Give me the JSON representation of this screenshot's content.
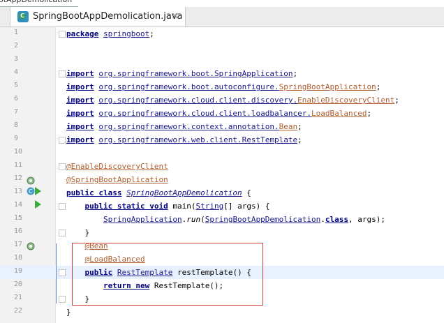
{
  "breadcrumb": "otAppDemolication",
  "tab": {
    "title": "SpringBootAppDemolication.java",
    "close": "×"
  },
  "lines": [
    {
      "n": "1",
      "html": "<span class=\"kw\">package</span> <span class=\"pk\">springboot</span>;"
    },
    {
      "n": "2",
      "html": ""
    },
    {
      "n": "3",
      "html": ""
    },
    {
      "n": "4",
      "html": "<span class=\"kw\">import</span> <span class=\"pk\">org.springframework.boot.SpringApplication</span>;"
    },
    {
      "n": "5",
      "html": "<span class=\"kw\">import</span> <span class=\"pk\">org.springframework.boot.autoconfigure.</span><span class=\"gi\">SpringBootApplication</span>;"
    },
    {
      "n": "6",
      "html": "<span class=\"kw\">import</span> <span class=\"pk\">org.springframework.cloud.client.discovery.</span><span class=\"gi\">EnableDiscoveryClient</span>;"
    },
    {
      "n": "7",
      "html": "<span class=\"kw\">import</span> <span class=\"pk\">org.springframework.cloud.client.loadbalancer.</span><span class=\"gi\">LoadBalanced</span>;"
    },
    {
      "n": "8",
      "html": "<span class=\"kw\">import</span> <span class=\"pk\">org.springframework.context.annotation.</span><span class=\"gi\">Bean</span>;"
    },
    {
      "n": "9",
      "html": "<span class=\"kw\">import</span> <span class=\"pk\">org.springframework.web.client.RestTemplate</span>;"
    },
    {
      "n": "10",
      "html": ""
    },
    {
      "n": "11",
      "html": "<span class=\"an\">@EnableDiscoveryClient</span>"
    },
    {
      "n": "12",
      "html": "<span class=\"an\">@SpringBootApplication</span>"
    },
    {
      "n": "13",
      "html": "<span class=\"kw\">public class</span> <span class=\"cl ital\">SpringBootAppDemolication</span> {"
    },
    {
      "n": "14",
      "html": "    <span class=\"kw\">public static void</span> main(<span class=\"cl\">String</span>[] args) {"
    },
    {
      "n": "15",
      "html": "        <span class=\"cl\">SpringApplication</span>.<span class=\"ital\">run</span>(<span class=\"cl\">SpringBootAppDemolication</span>.<span class=\"kw\">class</span>, args);"
    },
    {
      "n": "16",
      "html": "    }"
    },
    {
      "n": "17",
      "html": "    <span class=\"an\">@Bean</span>"
    },
    {
      "n": "18",
      "html": "    <span class=\"an\">@LoadBalanced</span>"
    },
    {
      "n": "19",
      "html": "    <span class=\"kw\">public</span> <span class=\"cl\">RestTemplate</span> restTemplate() {"
    },
    {
      "n": "20",
      "html": "        <span class=\"kw\">return new</span> RestTemplate();"
    },
    {
      "n": "21",
      "html": "    }"
    },
    {
      "n": "22",
      "html": "}"
    }
  ],
  "current_line": "19",
  "colors": {
    "keyword": "#000080",
    "annotation": "#b06030",
    "highlight_box": "#d43a3a"
  }
}
